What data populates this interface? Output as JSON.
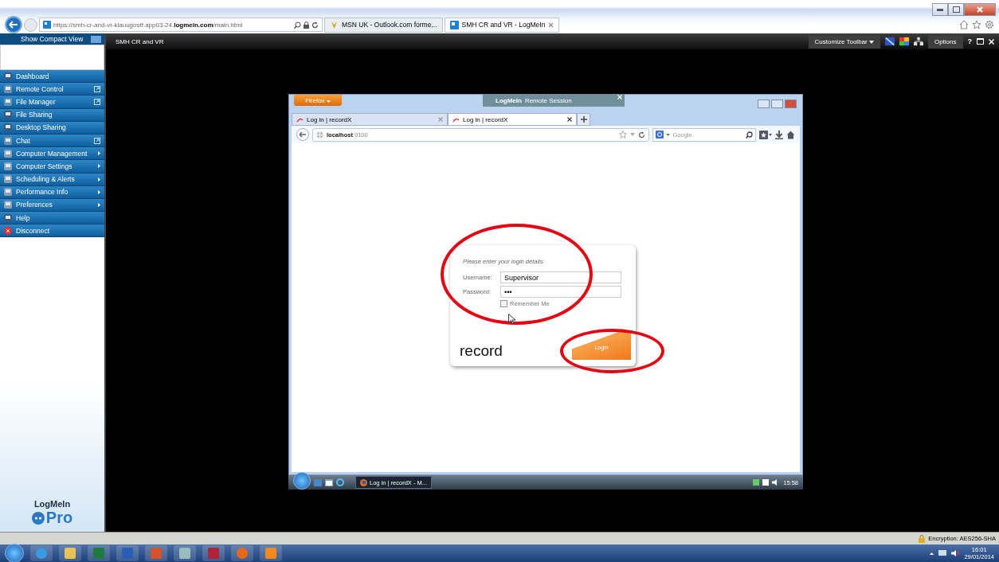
{
  "browser": {
    "address": "https://smh-cr-and-vr-klauugostf.app03-24.**logmein.com**/main.html",
    "tabs": [
      {
        "label": "MSN UK - Outlook.com forme...",
        "selected": false
      },
      {
        "label": "SMH CR and VR - LogMeIn",
        "selected": true
      }
    ]
  },
  "sidebar": {
    "header": "Show Compact View",
    "items": [
      {
        "label": "Dashboard",
        "kind": "plain"
      },
      {
        "label": "Remote Control",
        "kind": "popout"
      },
      {
        "label": "File Manager",
        "kind": "popout"
      },
      {
        "label": "File Sharing",
        "kind": "plain"
      },
      {
        "label": "Desktop Sharing",
        "kind": "plain"
      },
      {
        "label": "Chat",
        "kind": "popout"
      },
      {
        "label": "Computer Management",
        "kind": "submenu"
      },
      {
        "label": "Computer Settings",
        "kind": "submenu"
      },
      {
        "label": "Scheduling & Alerts",
        "kind": "submenu"
      },
      {
        "label": "Performance Info",
        "kind": "submenu"
      },
      {
        "label": "Preferences",
        "kind": "submenu"
      },
      {
        "label": "Help",
        "kind": "plain"
      },
      {
        "label": "Disconnect",
        "kind": "disconnect"
      }
    ],
    "logo": {
      "brand": "LogMeIn",
      "product": "Pro"
    }
  },
  "toolbar": {
    "title": "SMH CR and VR",
    "customize": "Customize Toolbar",
    "options": "Options",
    "help": "?"
  },
  "remote": {
    "banner": {
      "brand": "LogMeIn",
      "subtitle": "Remote Session"
    },
    "firefox": {
      "menu_button": "Firefox",
      "tabs": [
        {
          "label": "Log in | recordX",
          "selected": false
        },
        {
          "label": "Log in | recordX",
          "selected": true
        }
      ],
      "address": "**localhost**:9100",
      "search_placeholder": "Google"
    },
    "login": {
      "prompt": "Please enter your login details:",
      "username_label": "Username:",
      "username": "Supervisor",
      "password_label": "Password:",
      "password": "•••",
      "remember": {
        "label": "Remember Me",
        "checked": false
      },
      "logo": "record",
      "button": "Login"
    },
    "taskbar": {
      "task": "Log in | recordX - M...",
      "time": "15:58"
    }
  },
  "status_bar": {
    "encryption": "Encryption: AES256-SHA"
  },
  "taskbar": {
    "apps": [
      {
        "kind": "ie"
      },
      {
        "kind": "folder"
      },
      {
        "kind": "excel"
      },
      {
        "kind": "word"
      },
      {
        "kind": "powerpoint"
      },
      {
        "kind": "calculator"
      },
      {
        "kind": "access"
      },
      {
        "kind": "firefox"
      },
      {
        "kind": "media"
      }
    ],
    "time": "16:01",
    "date": "29/01/2014"
  }
}
